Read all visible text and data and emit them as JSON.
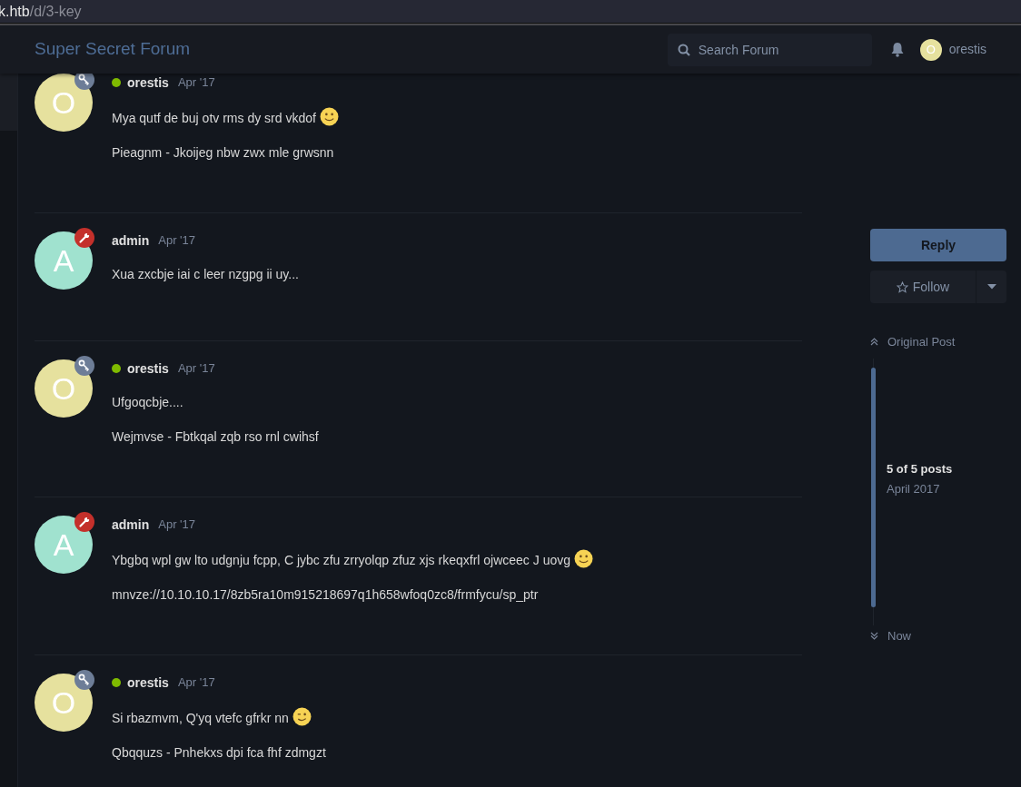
{
  "address_bar": {
    "host": "k.htb",
    "path": "/d/3-key"
  },
  "header": {
    "title": "Super Secret Forum",
    "search": {
      "placeholder": "Search Forum"
    },
    "user": {
      "initial": "O",
      "name": "orestis",
      "color": "#e6e19e"
    }
  },
  "posts": [
    {
      "author": "orestis",
      "initial": "O",
      "color": "#e6e19e",
      "badge": {
        "kind": "key"
      },
      "online": true,
      "date": "Apr '17",
      "paragraphs": [
        {
          "text": "Mya qutf de buj otv rms dy srd vkdof",
          "emoji": {
            "kind": "smile"
          }
        },
        {
          "text": "Pieagnm - Jkoijeg nbw zwx mle grwsnn"
        }
      ]
    },
    {
      "author": "admin",
      "initial": "A",
      "color": "#a0e2cf",
      "badge": {
        "kind": "wrench"
      },
      "online": false,
      "date": "Apr '17",
      "paragraphs": [
        {
          "text": "Xua zxcbje iai c leer nzgpg ii uy..."
        }
      ]
    },
    {
      "author": "orestis",
      "initial": "O",
      "color": "#e6e19e",
      "badge": {
        "kind": "key"
      },
      "online": true,
      "date": "Apr '17",
      "paragraphs": [
        {
          "text": "Ufgoqcbje...."
        },
        {
          "text": "Wejmvse - Fbtkqal zqb rso rnl cwihsf"
        }
      ]
    },
    {
      "author": "admin",
      "initial": "A",
      "color": "#a0e2cf",
      "badge": {
        "kind": "wrench"
      },
      "online": false,
      "date": "Apr '17",
      "paragraphs": [
        {
          "text": "Ybgbq wpl gw lto udgnju fcpp, C jybc zfu zrryolqp zfuz xjs rkeqxfrl ojwceec J uovg",
          "emoji": {
            "kind": "smile"
          }
        },
        {
          "text": "mnvze://10.10.10.17/8zb5ra10m915218697q1h658wfoq0zc8/frmfycu/sp_ptr"
        }
      ]
    },
    {
      "author": "orestis",
      "initial": "O",
      "color": "#e6e19e",
      "badge": {
        "kind": "key"
      },
      "online": true,
      "date": "Apr '17",
      "paragraphs": [
        {
          "text": "Si rbazmvm, Q'yq vtefc gfrkr nn",
          "emoji": {
            "kind": "wink"
          }
        },
        {
          "text": "Qbqquzs - Pnhekxs dpi fca fhf zdmgzt"
        }
      ]
    }
  ],
  "sidebar": {
    "reply_button": "Reply",
    "follow_button": "Follow",
    "scrubber": {
      "top_link": "Original Post",
      "position": "5 of 5 posts",
      "date": "April 2017",
      "bottom_link": "Now"
    }
  }
}
